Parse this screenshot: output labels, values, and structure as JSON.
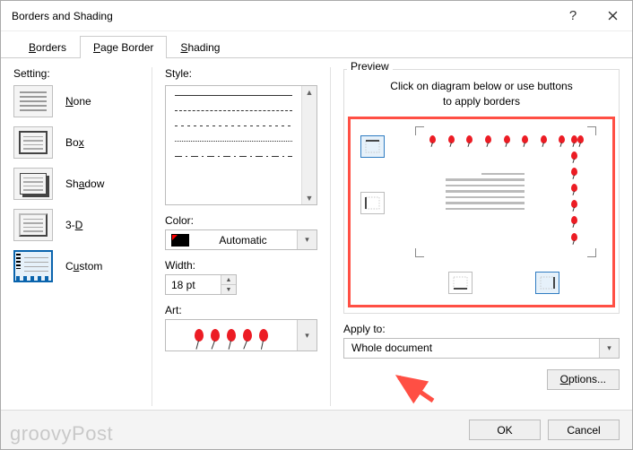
{
  "window": {
    "title": "Borders and Shading"
  },
  "tabs": {
    "borders_pre": "",
    "borders_ul": "B",
    "borders_post": "orders",
    "page_pre": "",
    "page_ul": "P",
    "page_post": "age Border",
    "shading_pre": "",
    "shading_ul": "S",
    "shading_post": "hading"
  },
  "setting": {
    "label": "Setting:",
    "none_ul": "N",
    "none_post": "one",
    "box_pre": "Bo",
    "box_ul": "x",
    "box_post": "",
    "shadow_pre": "Sh",
    "shadow_ul": "a",
    "shadow_post": "dow",
    "threeD_pre": "3-",
    "threeD_ul": "D",
    "threeD_post": "",
    "custom_pre": "C",
    "custom_ul": "u",
    "custom_post": "stom"
  },
  "style": {
    "label": "Style:",
    "color_label": "Color:",
    "color_value": "Automatic",
    "width_label": "Width:",
    "width_value": "18 pt",
    "art_label": "Art:"
  },
  "preview": {
    "legend": "Preview",
    "hint1": "Click on diagram below or use buttons",
    "hint2": "to apply borders",
    "apply_label": "Apply to:",
    "apply_value": "Whole document",
    "options_pre": "",
    "options_ul": "O",
    "options_post": "ptions..."
  },
  "footer": {
    "ok": "OK",
    "cancel": "Cancel"
  },
  "watermark": "groovyPost"
}
